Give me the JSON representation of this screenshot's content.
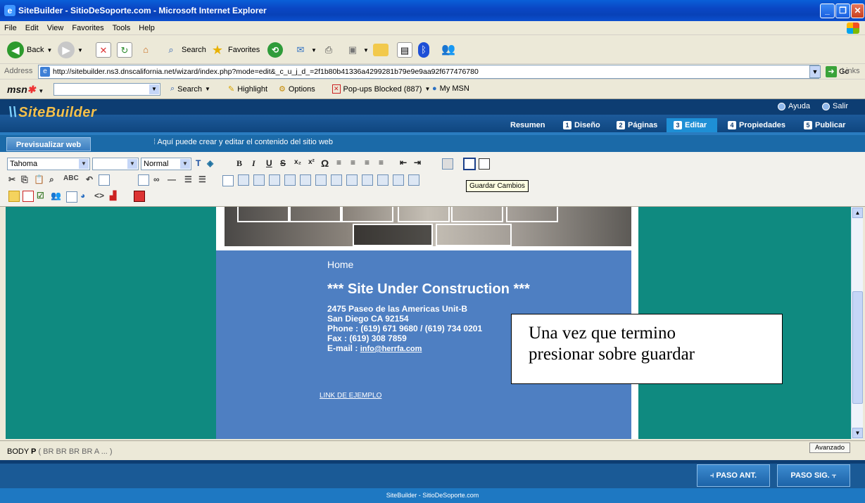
{
  "window": {
    "title": "SiteBuilder - SitioDeSoporte.com - Microsoft Internet Explorer",
    "controls": [
      "_",
      "❐",
      "✕"
    ]
  },
  "menu": [
    "File",
    "Edit",
    "View",
    "Favorites",
    "Tools",
    "Help"
  ],
  "toolbar": {
    "back": "Back",
    "search": "Search",
    "favorites": "Favorites"
  },
  "address": {
    "label": "Address",
    "url": "http://sitebuilder.ns3.dnscalifornia.net/wizard/index.php?mode=edit&_c_u_j_d_=2f1b80b41336a4299281b79e9e9aa92f677476780",
    "go": "Go",
    "links": "Links"
  },
  "msn": {
    "logo": "msn",
    "search": "Search",
    "highlight": "Highlight",
    "options": "Options",
    "popups": "Pop-ups Blocked (887)",
    "mymsn": "My MSN"
  },
  "sitebuilder": {
    "logo": "SiteBuilder",
    "help": "Ayuda",
    "exit": "Salir",
    "nav": [
      {
        "num": "",
        "label": "Resumen"
      },
      {
        "num": "1",
        "label": "Diseño"
      },
      {
        "num": "2",
        "label": "Páginas"
      },
      {
        "num": "3",
        "label": "Editar"
      },
      {
        "num": "4",
        "label": "Propiedades"
      },
      {
        "num": "5",
        "label": "Publicar"
      }
    ],
    "preview_button": "Previsualizar web",
    "info": "Aquí puede crear y editar el contenido del sitio web"
  },
  "editor": {
    "font": "Tahoma",
    "size": "",
    "style": "Normal",
    "tooltip": "Guardar Cambios"
  },
  "page": {
    "home": "Home",
    "heading": "*** Site Under Construction ***",
    "address1": "2475 Paseo de las Americas Unit-B",
    "address2": "San Diego CA 92154",
    "phone": "Phone : (619) 671 9680 / (619) 734 0201",
    "fax": "Fax : (619) 308 7859",
    "email_label": "E-mail : ",
    "email": "info@herrfa.com",
    "example_link": "LINK DE EJEMPLO"
  },
  "callout": {
    "line1": "Una vez que termino",
    "line2": "presionar sobre guardar"
  },
  "status": {
    "path_tag": "BODY",
    "path_p": "P",
    "path_rest": "( BR BR BR BR A ... )",
    "advanced": "Avanzado"
  },
  "footer": {
    "prev": "PASO ANT.",
    "next": "PASO SIG.",
    "copyright": "SiteBuilder - SitioDeSoporte.com"
  }
}
